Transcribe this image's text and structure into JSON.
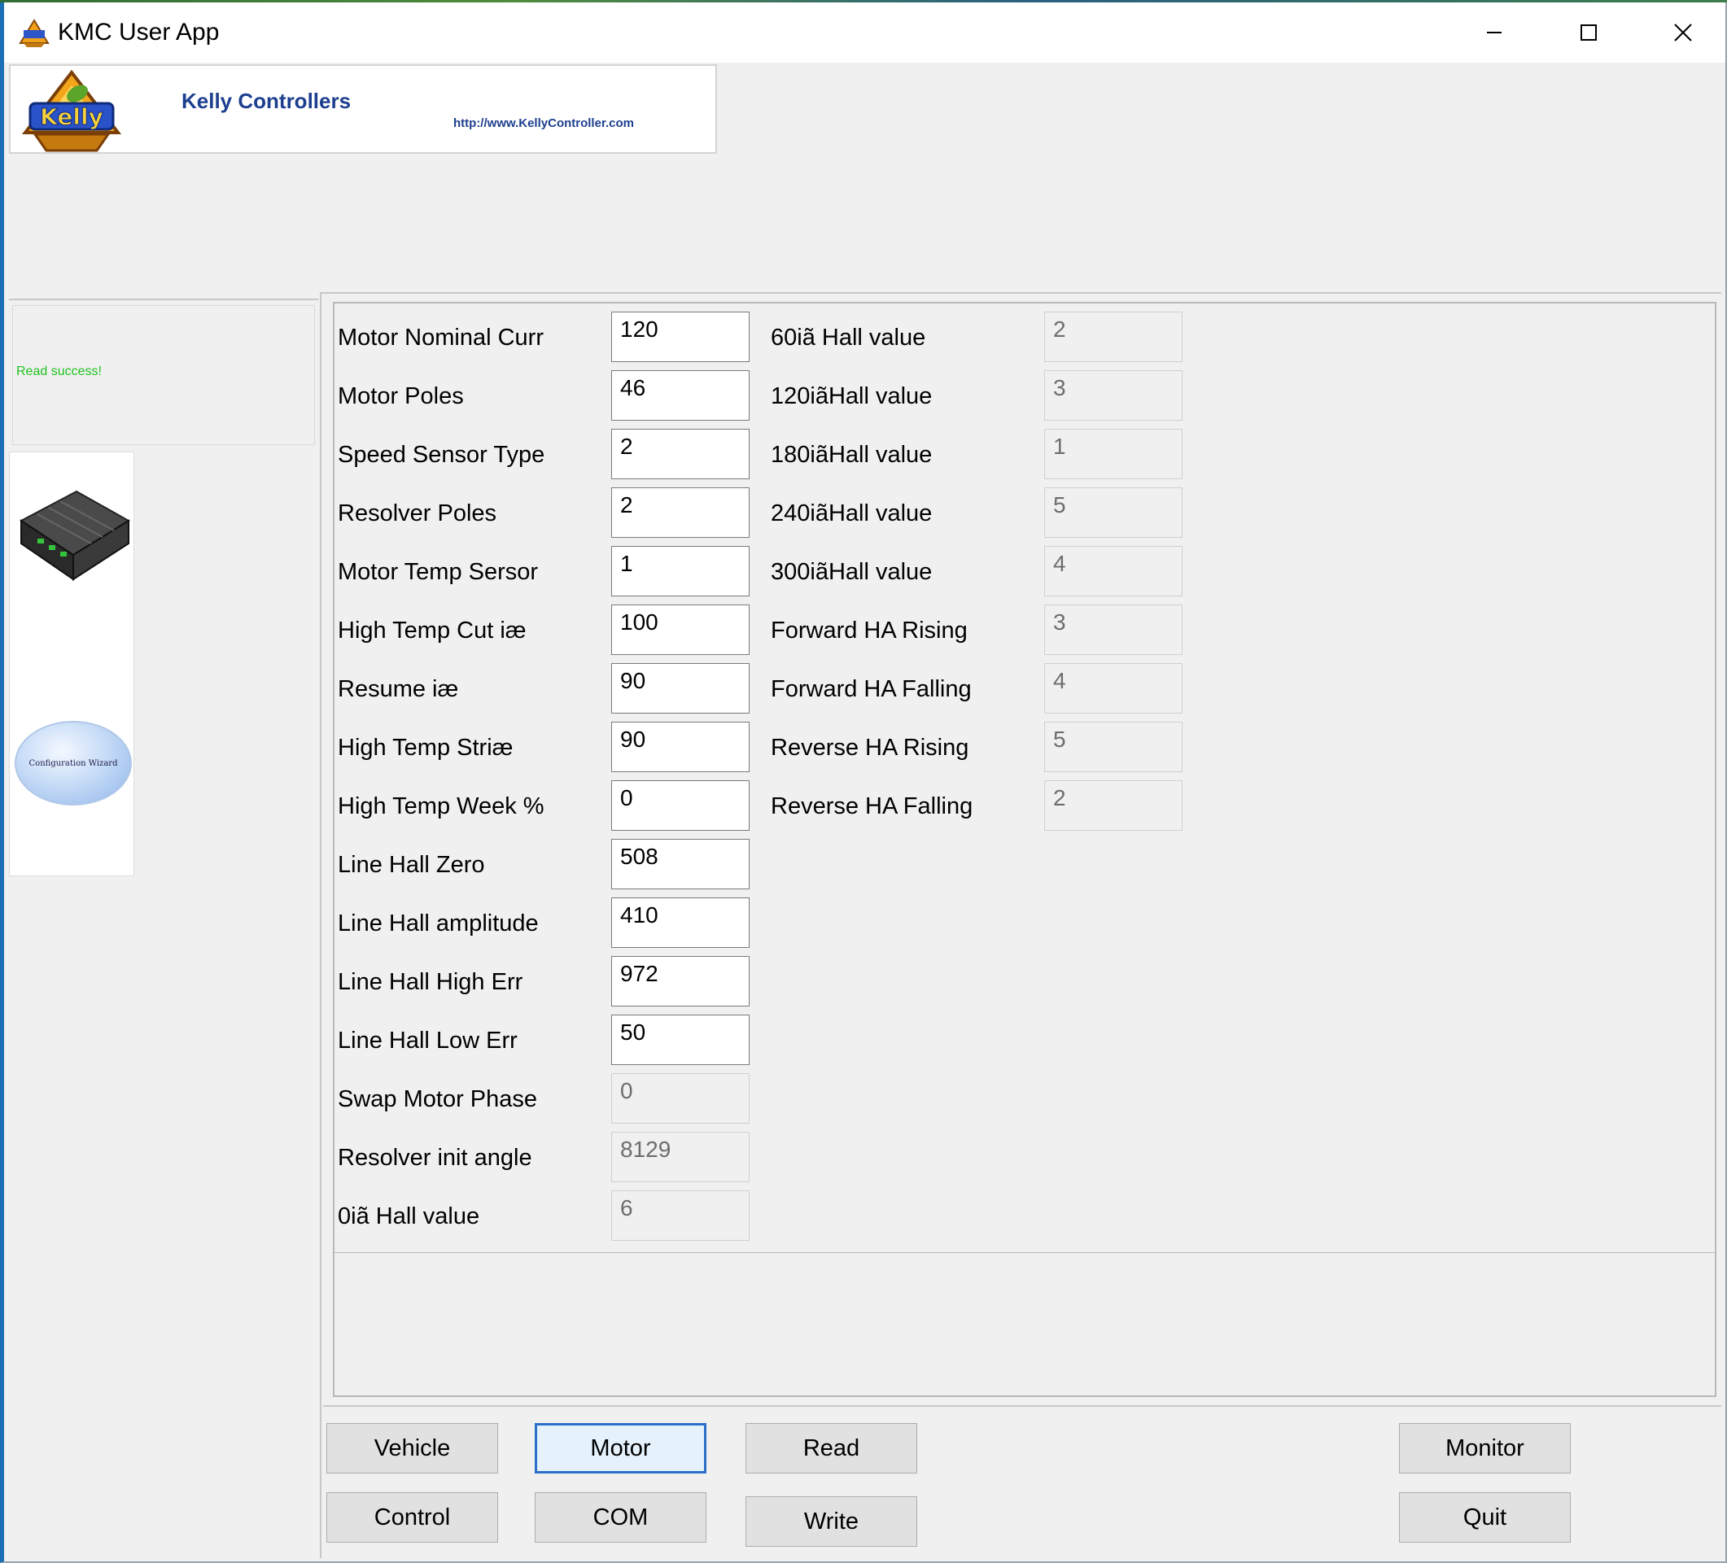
{
  "window": {
    "title": "KMC User App",
    "controls": {
      "minimize": "minimize",
      "maximize": "maximize",
      "close": "close"
    }
  },
  "banner": {
    "logo_text": "Kelly",
    "company": "Kelly Controllers",
    "url": "http://www.KellyController.com"
  },
  "status": {
    "message": "Read success!"
  },
  "sidebar": {
    "wizard_label": "Configuration Wizard"
  },
  "left_fields": [
    {
      "label": "Motor Nominal Curr",
      "value": "120",
      "editable": true
    },
    {
      "label": "Motor Poles",
      "value": "46",
      "editable": true
    },
    {
      "label": "Speed Sensor Type",
      "value": "2",
      "editable": true
    },
    {
      "label": "Resolver Poles",
      "value": "2",
      "editable": true
    },
    {
      "label": "Motor Temp Sersor",
      "value": "1",
      "editable": true
    },
    {
      "label": "High Temp Cut iæ",
      "value": "100",
      "editable": true
    },
    {
      "label": "Resume iæ",
      "value": "90",
      "editable": true
    },
    {
      "label": "High Temp Striæ",
      "value": "90",
      "editable": true
    },
    {
      "label": "High Temp Week %",
      "value": "0",
      "editable": true
    },
    {
      "label": "Line Hall Zero",
      "value": "508",
      "editable": true
    },
    {
      "label": "Line Hall amplitude",
      "value": "410",
      "editable": true
    },
    {
      "label": "Line Hall High Err",
      "value": "972",
      "editable": true
    },
    {
      "label": "Line Hall Low Err",
      "value": "50",
      "editable": true
    },
    {
      "label": "Swap Motor Phase",
      "value": "0",
      "editable": false
    },
    {
      "label": "Resolver init angle",
      "value": "8129",
      "editable": false
    },
    {
      "label": "0iã  Hall value",
      "value": "6",
      "editable": false
    }
  ],
  "right_fields": [
    {
      "label": "60iã Hall value",
      "value": "2",
      "editable": false
    },
    {
      "label": "120iãHall value",
      "value": "3",
      "editable": false
    },
    {
      "label": "180iãHall value",
      "value": "1",
      "editable": false
    },
    {
      "label": "240iãHall value",
      "value": "5",
      "editable": false
    },
    {
      "label": "300iãHall value",
      "value": "4",
      "editable": false
    },
    {
      "label": "Forward HA Rising",
      "value": "3",
      "editable": false
    },
    {
      "label": "Forward HA Falling",
      "value": "4",
      "editable": false
    },
    {
      "label": "Reverse HA Rising",
      "value": "5",
      "editable": false
    },
    {
      "label": "Reverse HA Falling",
      "value": "2",
      "editable": false
    }
  ],
  "buttons": {
    "vehicle": "Vehicle",
    "motor": "Motor",
    "read": "Read",
    "monitor": "Monitor",
    "control": "Control",
    "com": "COM",
    "write": "Write",
    "quit": "Quit"
  },
  "colors": {
    "status_text": "#1ec21e",
    "brand_blue": "#1d3f8f",
    "focus_border": "#2a6fc9"
  }
}
